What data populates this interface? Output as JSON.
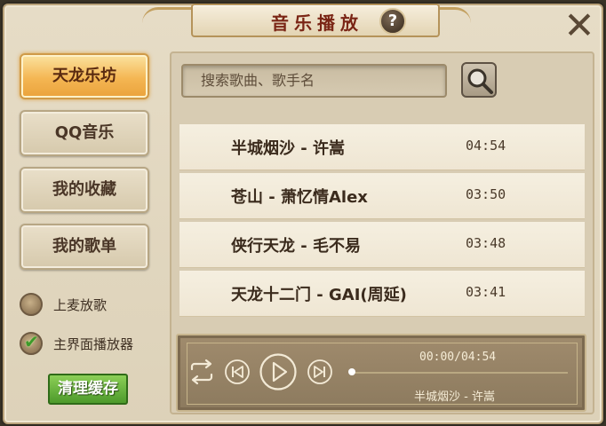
{
  "title": "音乐播放",
  "help_label": "?",
  "close_label": "✕",
  "menu": [
    {
      "label": "天龙乐坊",
      "active": true
    },
    {
      "label": "QQ音乐",
      "active": false
    },
    {
      "label": "我的收藏",
      "active": false
    },
    {
      "label": "我的歌单",
      "active": false
    }
  ],
  "options": [
    {
      "label": "上麦放歌",
      "checked": false
    },
    {
      "label": "主界面播放器",
      "checked": true
    }
  ],
  "clear_cache_label": "清理缓存",
  "search": {
    "placeholder": "搜索歌曲、歌手名"
  },
  "songs": [
    {
      "title": "半城烟沙 - 许嵩",
      "duration": "04:54"
    },
    {
      "title": "苍山 - 萧忆情Alex",
      "duration": "03:50"
    },
    {
      "title": "侠行天龙 - 毛不易",
      "duration": "03:48"
    },
    {
      "title": "天龙十二门 - GAI(周延)",
      "duration": "03:41"
    }
  ],
  "player": {
    "time": "00:00/04:54",
    "now_playing": "半城烟沙 - 许嵩",
    "progress": 0
  },
  "colors": {
    "accent_gold": "#f4b653",
    "title_red": "#7a2515",
    "clear_green": "#4d9a2b"
  }
}
